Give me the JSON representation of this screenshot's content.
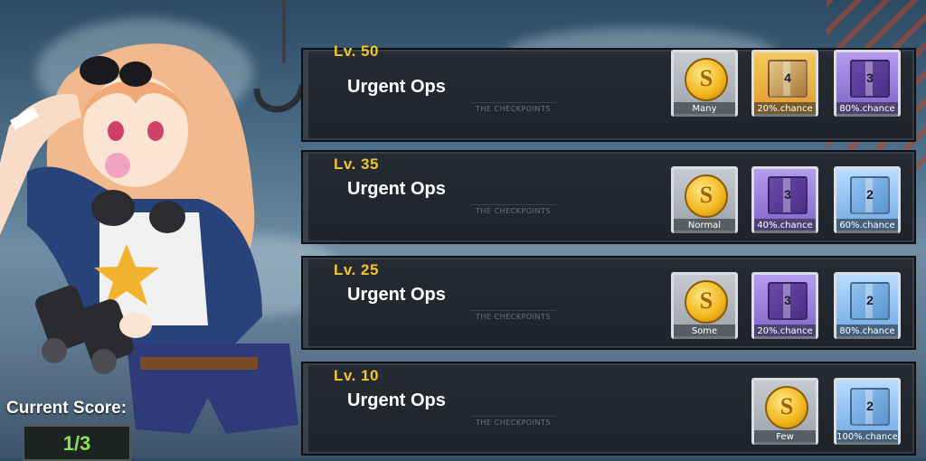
{
  "score": {
    "label": "Current Score:",
    "value": "1/3"
  },
  "missions": [
    {
      "level": "Lv. 50",
      "title": "Urgent Ops",
      "subtitle": "THE CHECKPOINTS",
      "rewards": [
        {
          "type": "coin",
          "caption": "Many",
          "tone": "grey"
        },
        {
          "type": "box",
          "caption": "20%.chance",
          "tone": "gold",
          "box": "gold",
          "number": "4"
        },
        {
          "type": "box",
          "caption": "80%.chance",
          "tone": "purple",
          "box": "purple",
          "number": "3"
        }
      ]
    },
    {
      "level": "Lv. 35",
      "title": "Urgent Ops",
      "subtitle": "THE CHECKPOINTS",
      "rewards": [
        {
          "type": "coin",
          "caption": "Normal",
          "tone": "grey"
        },
        {
          "type": "box",
          "caption": "40%.chance",
          "tone": "purple",
          "box": "purple",
          "number": "3"
        },
        {
          "type": "box",
          "caption": "60%.chance",
          "tone": "blue",
          "box": "blue",
          "number": "2"
        }
      ]
    },
    {
      "level": "Lv. 25",
      "title": "Urgent Ops",
      "subtitle": "THE CHECKPOINTS",
      "rewards": [
        {
          "type": "coin",
          "caption": "Some",
          "tone": "grey"
        },
        {
          "type": "box",
          "caption": "20%.chance",
          "tone": "purple",
          "box": "purple",
          "number": "3"
        },
        {
          "type": "box",
          "caption": "80%.chance",
          "tone": "blue",
          "box": "blue",
          "number": "2"
        }
      ]
    },
    {
      "level": "Lv. 10",
      "title": "Urgent Ops",
      "subtitle": "THE CHECKPOINTS",
      "rewards": [
        {
          "type": "coin",
          "caption": "Few",
          "tone": "grey"
        },
        {
          "type": "box",
          "caption": "100%.chance",
          "tone": "blue",
          "box": "blue",
          "number": "2"
        }
      ]
    }
  ],
  "colors": {
    "level_text": "#f3c529",
    "score_text": "#8be055",
    "panel_bg": "#22272e"
  }
}
